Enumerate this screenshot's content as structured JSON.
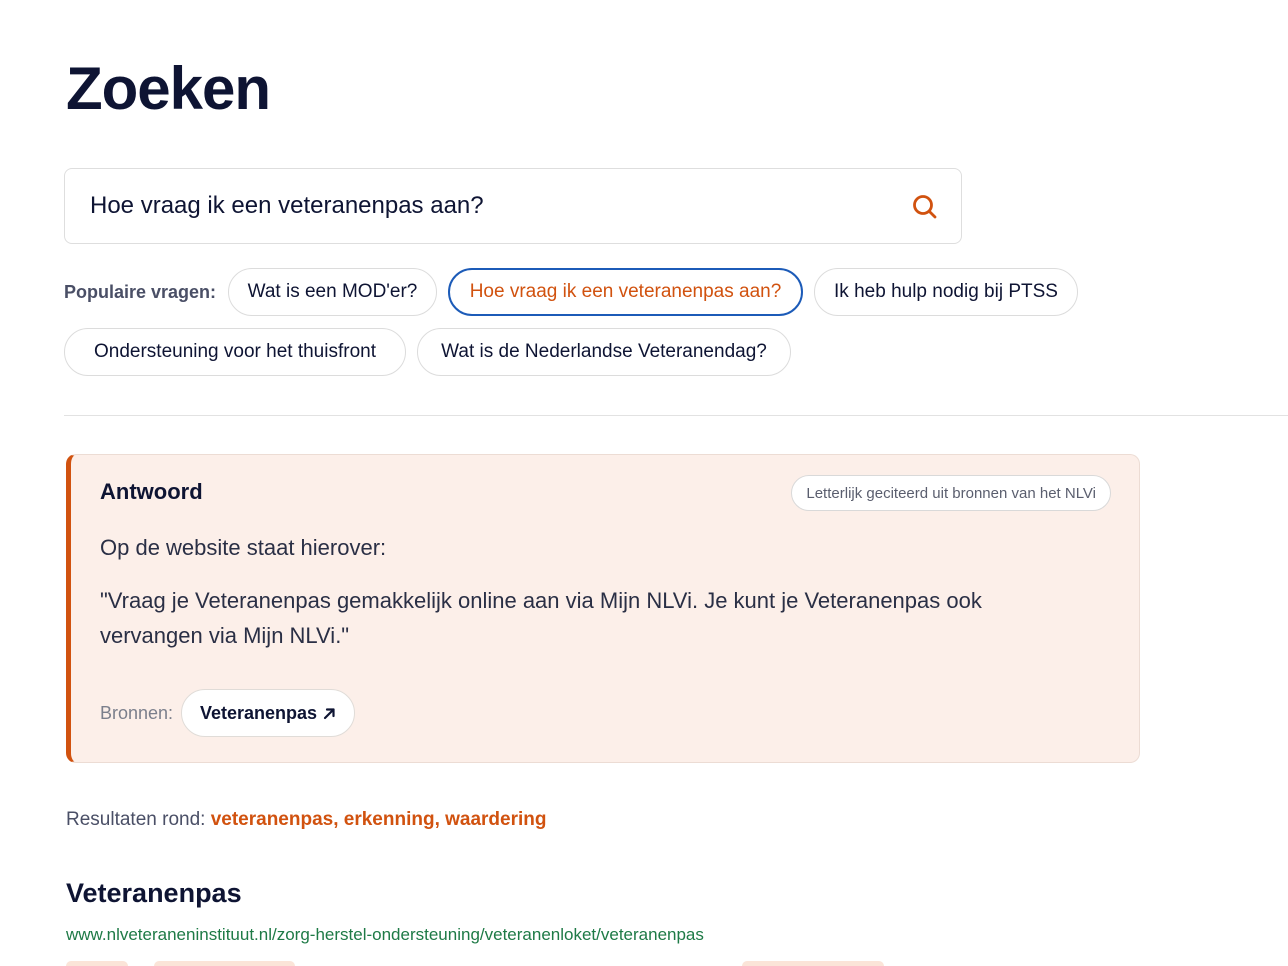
{
  "page": {
    "title": "Zoeken"
  },
  "search": {
    "value": "Hoe vraag ik een veteranenpas aan?",
    "icon": "search-icon",
    "accent_color": "#d1520f"
  },
  "popular": {
    "label": "Populaire vragen:",
    "questions": [
      "Wat is een MOD'er?",
      "Hoe vraag ik een veteranenpas aan?",
      "Ik heb hulp nodig bij PTSS",
      "Ondersteuning voor het thuisfront",
      "Wat is de Nederlandse Veteranendag?"
    ],
    "active_index": 1
  },
  "answer": {
    "title": "Antwoord",
    "badge": "Letterlijk geciteerd uit bronnen van het NLVi",
    "intro": "Op de website staat hierover:",
    "quote": "\"Vraag je Veteranenpas gemakkelijk online aan via Mijn NLVi. Je kunt je Veteranenpas ook vervangen via Mijn NLVi.\"",
    "sources_label": "Bronnen:",
    "sources": [
      {
        "label": "Veteranenpas",
        "icon": "external-arrow-icon"
      }
    ]
  },
  "results": {
    "about_label": "Resultaten rond:",
    "keywords": "veteranenpas, erkenning, waardering",
    "items": [
      {
        "title": "Veteranenpas",
        "url": "www.nlveteraneninstituut.nl/zorg-herstel-ondersteuning/veteranenloket/veteranenpas"
      }
    ]
  },
  "colors": {
    "brand_orange": "#d1520f",
    "navy": "#0e1433",
    "answer_bg": "#fcefe9",
    "url_green": "#1e7a46",
    "focus_blue": "#1c5bb8"
  }
}
